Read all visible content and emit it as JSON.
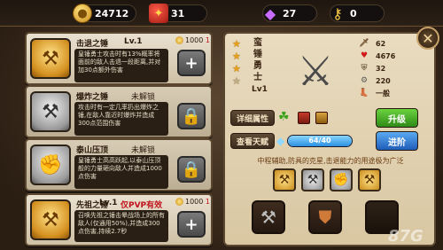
{
  "resources": {
    "coins": "24712",
    "gifts": "31",
    "gems": "27",
    "keys": "0"
  },
  "skills": [
    {
      "name": "击退之锤",
      "level": "Lv.1",
      "tag": "",
      "cost": "1000",
      "cost_extra": "1",
      "desc": "皇锤勇士攻击时有13%概率将面前的敌人击退一段距离,并对加30点额外伤害",
      "action": "+",
      "locked": false,
      "icon": "hammer-gold"
    },
    {
      "name": "爆炸之锤",
      "level": "",
      "tag": "未解锁",
      "cost": "",
      "cost_extra": "",
      "desc": "攻击时有一定几率扔出爆炸之锤,在敌人靠近时爆炸并造成300点范围伤害",
      "action": "lock",
      "locked": true,
      "icon": "hammer-gray"
    },
    {
      "name": "泰山压顶",
      "level": "",
      "tag": "未解锁",
      "cost": "",
      "cost_extra": "",
      "desc": "皇锤勇士高高跃起,以泰山压顶般的力量砸向敌人并造成1000点伤害",
      "action": "lock",
      "locked": true,
      "icon": "slam-gray"
    },
    {
      "name": "先祖之锤",
      "level": "Lv.1",
      "tag": "仅PVP有效",
      "cost": "1000",
      "cost_extra": "1",
      "desc": "召唤先祖之锤击晕战场上的所有敌人(仅通用50%),并造成300点伤害,持续2.7秒",
      "action": "+",
      "locked": false,
      "icon": "hammer-ancestor"
    }
  ],
  "hero": {
    "name_chars": [
      "蛮",
      "锤",
      "勇",
      "士"
    ],
    "level": "Lv1",
    "stars_on": 3,
    "stars_total": 4,
    "stats": [
      {
        "icon": "sword-icon",
        "value": "62"
      },
      {
        "icon": "heart-icon",
        "value": "4676"
      },
      {
        "icon": "shield-icon",
        "value": "32"
      },
      {
        "icon": "gear-icon",
        "value": "220"
      },
      {
        "icon": "boot-icon",
        "value": "一般"
      }
    ],
    "detail_label": "详细属性",
    "upgrade_label": "升级",
    "talent_label": "查看天赋",
    "advance_label": "进阶",
    "progress_text": "64/40",
    "progress_fraction": 1.0,
    "description": "中程辅助,防具的克星,击退能力的用途极为广泛"
  },
  "watermark": "87G"
}
